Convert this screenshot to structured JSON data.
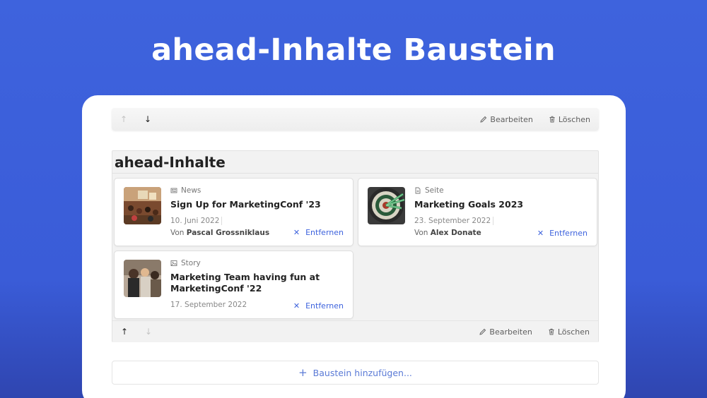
{
  "hero": {
    "title": "ahead-Inhalte Baustein"
  },
  "toolbar": {
    "up_icon": "arrow-up-icon",
    "down_icon": "arrow-down-icon",
    "edit_label": "Bearbeiten",
    "delete_label": "Löschen"
  },
  "block": {
    "title": "ahead-Inhalte",
    "cards": [
      {
        "type": "News",
        "type_icon": "newspaper-icon",
        "title": "Sign Up for MarketingConf '23",
        "date": "10. Juni 2022",
        "author_prefix": "Von",
        "author": "Pascal Grossniklaus",
        "remove_label": "Entfernen"
      },
      {
        "type": "Seite",
        "type_icon": "document-icon",
        "title": "Marketing Goals 2023",
        "date": "23. September 2022",
        "author_prefix": "Von",
        "author": "Alex Donate",
        "remove_label": "Entfernen"
      },
      {
        "type": "Story",
        "type_icon": "image-icon",
        "title": "Marketing Team having fun at MarketingConf '22",
        "date": "17. September 2022",
        "remove_label": "Entfernen"
      }
    ]
  },
  "add_block": {
    "label": "Baustein hinzufügen..."
  },
  "colors": {
    "background": "#3e63dd",
    "accent": "#3e63dd",
    "panel": "#ffffff"
  }
}
